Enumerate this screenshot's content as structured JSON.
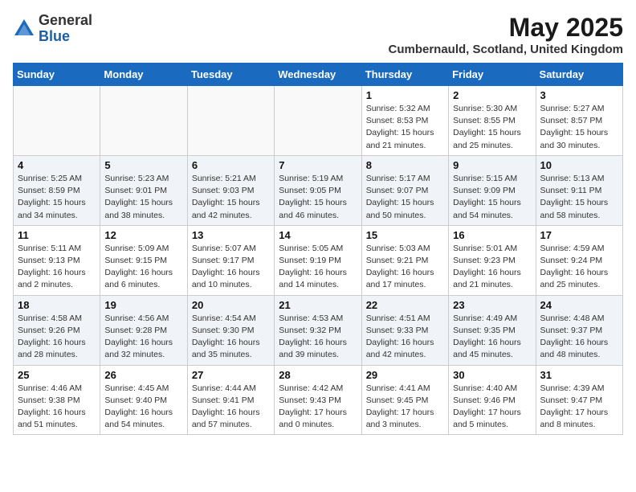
{
  "header": {
    "logo_general": "General",
    "logo_blue": "Blue",
    "month_title": "May 2025",
    "location": "Cumbernauld, Scotland, United Kingdom"
  },
  "days_of_week": [
    "Sunday",
    "Monday",
    "Tuesday",
    "Wednesday",
    "Thursday",
    "Friday",
    "Saturday"
  ],
  "weeks": [
    [
      {
        "day": "",
        "info": ""
      },
      {
        "day": "",
        "info": ""
      },
      {
        "day": "",
        "info": ""
      },
      {
        "day": "",
        "info": ""
      },
      {
        "day": "1",
        "info": "Sunrise: 5:32 AM\nSunset: 8:53 PM\nDaylight: 15 hours\nand 21 minutes."
      },
      {
        "day": "2",
        "info": "Sunrise: 5:30 AM\nSunset: 8:55 PM\nDaylight: 15 hours\nand 25 minutes."
      },
      {
        "day": "3",
        "info": "Sunrise: 5:27 AM\nSunset: 8:57 PM\nDaylight: 15 hours\nand 30 minutes."
      }
    ],
    [
      {
        "day": "4",
        "info": "Sunrise: 5:25 AM\nSunset: 8:59 PM\nDaylight: 15 hours\nand 34 minutes."
      },
      {
        "day": "5",
        "info": "Sunrise: 5:23 AM\nSunset: 9:01 PM\nDaylight: 15 hours\nand 38 minutes."
      },
      {
        "day": "6",
        "info": "Sunrise: 5:21 AM\nSunset: 9:03 PM\nDaylight: 15 hours\nand 42 minutes."
      },
      {
        "day": "7",
        "info": "Sunrise: 5:19 AM\nSunset: 9:05 PM\nDaylight: 15 hours\nand 46 minutes."
      },
      {
        "day": "8",
        "info": "Sunrise: 5:17 AM\nSunset: 9:07 PM\nDaylight: 15 hours\nand 50 minutes."
      },
      {
        "day": "9",
        "info": "Sunrise: 5:15 AM\nSunset: 9:09 PM\nDaylight: 15 hours\nand 54 minutes."
      },
      {
        "day": "10",
        "info": "Sunrise: 5:13 AM\nSunset: 9:11 PM\nDaylight: 15 hours\nand 58 minutes."
      }
    ],
    [
      {
        "day": "11",
        "info": "Sunrise: 5:11 AM\nSunset: 9:13 PM\nDaylight: 16 hours\nand 2 minutes."
      },
      {
        "day": "12",
        "info": "Sunrise: 5:09 AM\nSunset: 9:15 PM\nDaylight: 16 hours\nand 6 minutes."
      },
      {
        "day": "13",
        "info": "Sunrise: 5:07 AM\nSunset: 9:17 PM\nDaylight: 16 hours\nand 10 minutes."
      },
      {
        "day": "14",
        "info": "Sunrise: 5:05 AM\nSunset: 9:19 PM\nDaylight: 16 hours\nand 14 minutes."
      },
      {
        "day": "15",
        "info": "Sunrise: 5:03 AM\nSunset: 9:21 PM\nDaylight: 16 hours\nand 17 minutes."
      },
      {
        "day": "16",
        "info": "Sunrise: 5:01 AM\nSunset: 9:23 PM\nDaylight: 16 hours\nand 21 minutes."
      },
      {
        "day": "17",
        "info": "Sunrise: 4:59 AM\nSunset: 9:24 PM\nDaylight: 16 hours\nand 25 minutes."
      }
    ],
    [
      {
        "day": "18",
        "info": "Sunrise: 4:58 AM\nSunset: 9:26 PM\nDaylight: 16 hours\nand 28 minutes."
      },
      {
        "day": "19",
        "info": "Sunrise: 4:56 AM\nSunset: 9:28 PM\nDaylight: 16 hours\nand 32 minutes."
      },
      {
        "day": "20",
        "info": "Sunrise: 4:54 AM\nSunset: 9:30 PM\nDaylight: 16 hours\nand 35 minutes."
      },
      {
        "day": "21",
        "info": "Sunrise: 4:53 AM\nSunset: 9:32 PM\nDaylight: 16 hours\nand 39 minutes."
      },
      {
        "day": "22",
        "info": "Sunrise: 4:51 AM\nSunset: 9:33 PM\nDaylight: 16 hours\nand 42 minutes."
      },
      {
        "day": "23",
        "info": "Sunrise: 4:49 AM\nSunset: 9:35 PM\nDaylight: 16 hours\nand 45 minutes."
      },
      {
        "day": "24",
        "info": "Sunrise: 4:48 AM\nSunset: 9:37 PM\nDaylight: 16 hours\nand 48 minutes."
      }
    ],
    [
      {
        "day": "25",
        "info": "Sunrise: 4:46 AM\nSunset: 9:38 PM\nDaylight: 16 hours\nand 51 minutes."
      },
      {
        "day": "26",
        "info": "Sunrise: 4:45 AM\nSunset: 9:40 PM\nDaylight: 16 hours\nand 54 minutes."
      },
      {
        "day": "27",
        "info": "Sunrise: 4:44 AM\nSunset: 9:41 PM\nDaylight: 16 hours\nand 57 minutes."
      },
      {
        "day": "28",
        "info": "Sunrise: 4:42 AM\nSunset: 9:43 PM\nDaylight: 17 hours\nand 0 minutes."
      },
      {
        "day": "29",
        "info": "Sunrise: 4:41 AM\nSunset: 9:45 PM\nDaylight: 17 hours\nand 3 minutes."
      },
      {
        "day": "30",
        "info": "Sunrise: 4:40 AM\nSunset: 9:46 PM\nDaylight: 17 hours\nand 5 minutes."
      },
      {
        "day": "31",
        "info": "Sunrise: 4:39 AM\nSunset: 9:47 PM\nDaylight: 17 hours\nand 8 minutes."
      }
    ]
  ]
}
